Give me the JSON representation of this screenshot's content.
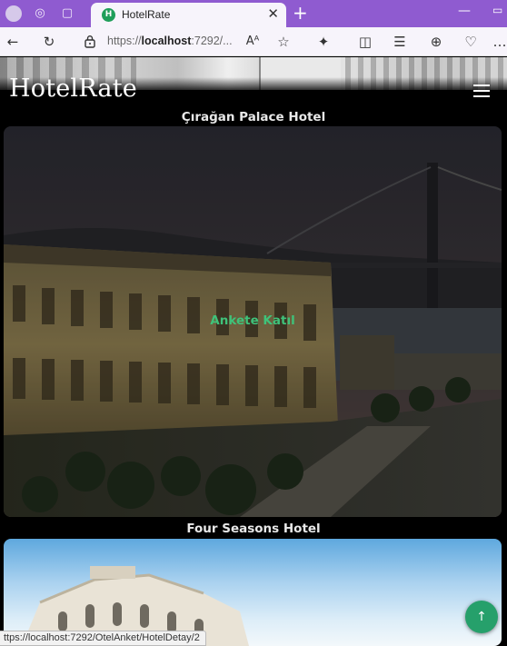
{
  "browser": {
    "tab_title": "HotelRate",
    "tab_favicon_letter": "H",
    "tab_close": "✕",
    "new_tab": "+",
    "url_prefix": "https://",
    "url_host": "localhost",
    "url_rest": ":7292/...",
    "status_url": "ttps://localhost:7292/OtelAnket/HotelDetay/2"
  },
  "site": {
    "brand": "HotelRate"
  },
  "hotels": [
    {
      "name": "Çırağan Palace Hotel",
      "cta": "Ankete Katıl"
    },
    {
      "name": "Four Seasons Hotel"
    }
  ],
  "scroll_top": "↑"
}
